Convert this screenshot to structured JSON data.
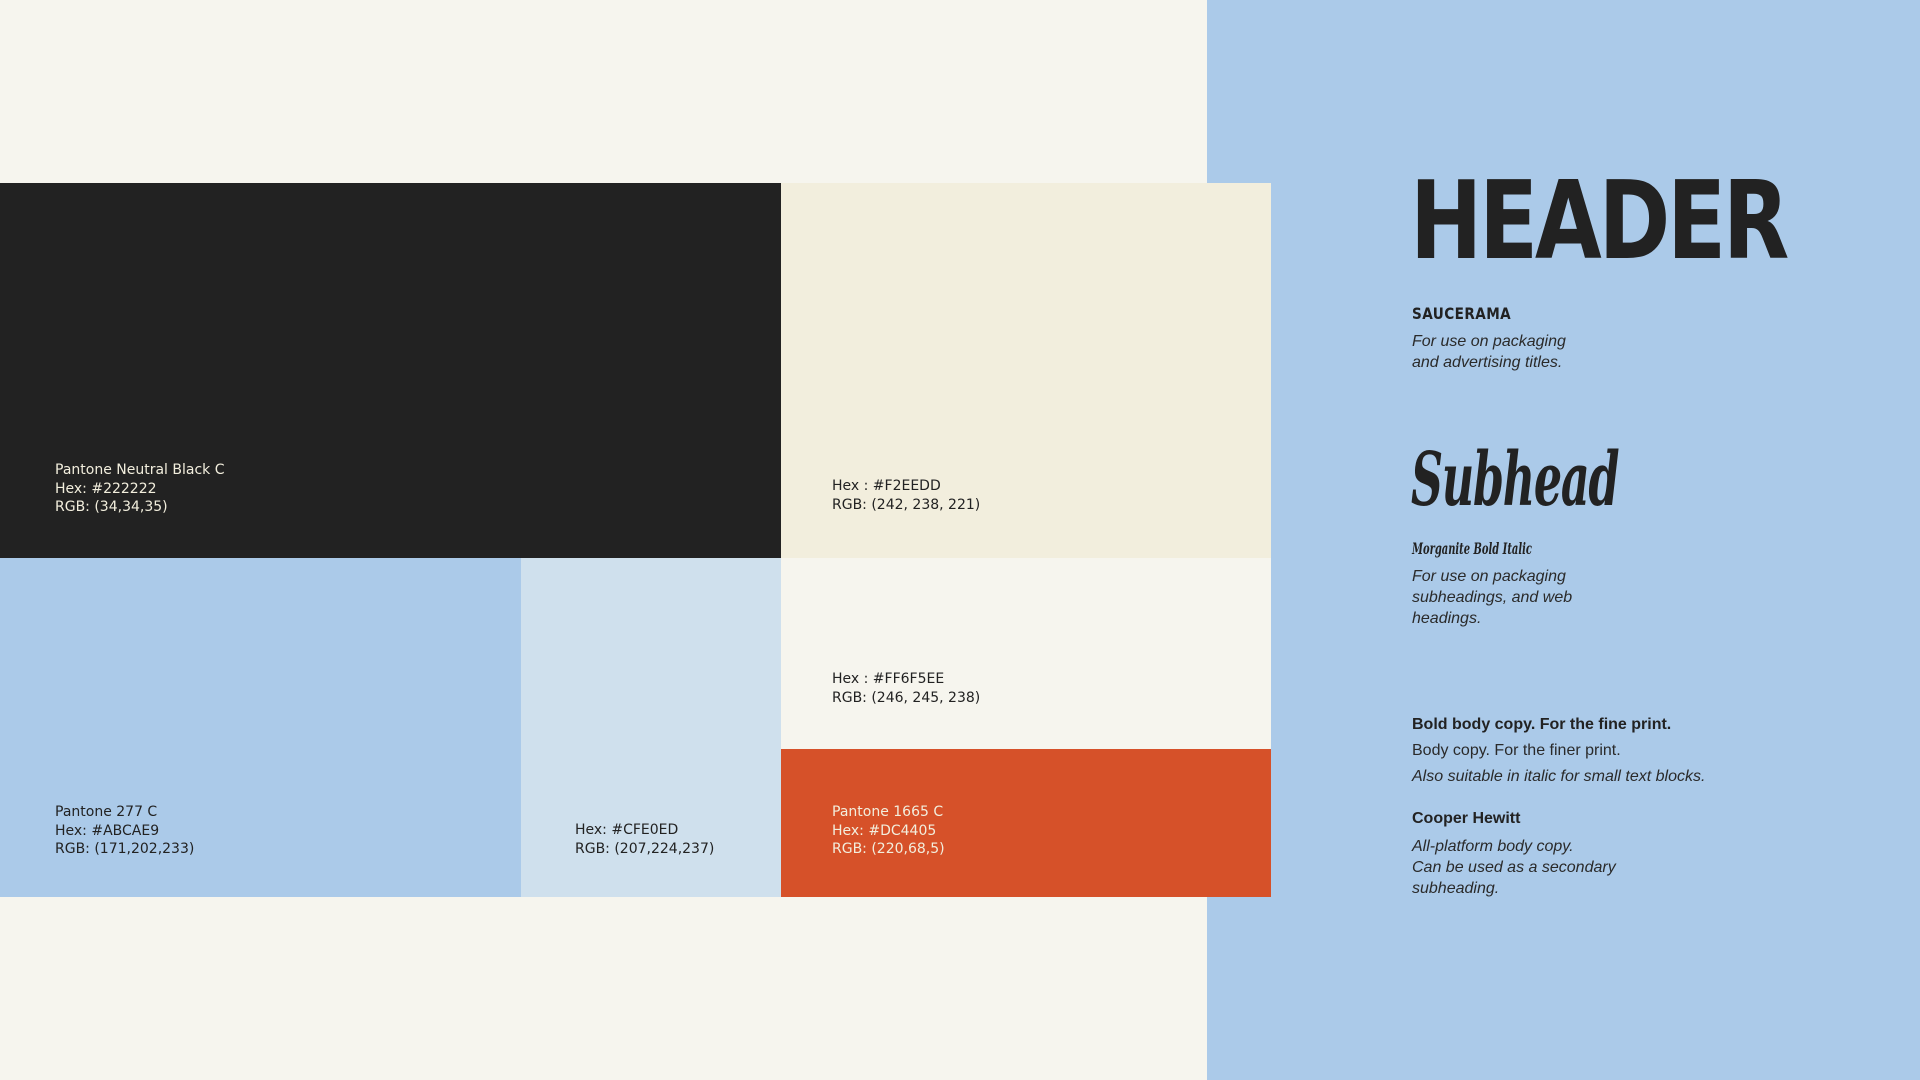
{
  "colors": {
    "neutral_black": "#222222",
    "cream": "#F2EEDD",
    "blue": "#ABCAE9",
    "light_blue": "#CFE0ED",
    "off_white": "#FF6F5EE",
    "orange": "#DC4405"
  },
  "swatches": {
    "black": {
      "name": "Pantone Neutral Black C",
      "hex": "Hex: #222222",
      "rgb": "RGB: (34,34,35)"
    },
    "cream": {
      "hex": "Hex : #F2EEDD",
      "rgb": "RGB: (242, 238, 221)"
    },
    "blue": {
      "name": "Pantone 277 C",
      "hex": "Hex: #ABCAE9",
      "rgb": "RGB: (171,202,233)"
    },
    "light_blue": {
      "hex": "Hex: #CFE0ED",
      "rgb": "RGB: (207,224,237)"
    },
    "off_white": {
      "hex": "Hex : #FF6F5EE",
      "rgb": "RGB: (246, 245, 238)"
    },
    "orange": {
      "name": "Pantone 1665 C",
      "hex": "Hex: #DC4405",
      "rgb": "RGB: (220,68,5)"
    }
  },
  "typography": {
    "header": {
      "sample": "HEADER",
      "font_name": "SAUCERAMA",
      "desc_line1": "For use on packaging",
      "desc_line2": "and advertising titles."
    },
    "subhead": {
      "sample": "Subhead",
      "font_name": "Morganite Bold Italic",
      "desc_line1": "For use on packaging",
      "desc_line2": "subheadings, and web",
      "desc_line3": "headings."
    },
    "body": {
      "bold_sample": "Bold body copy. For the fine print.",
      "regular_sample": "Body copy. For the finer print.",
      "italic_sample": "Also suitable in italic for small text blocks.",
      "font_name": "Cooper Hewitt",
      "desc_line1": "All-platform body copy.",
      "desc_line2": "Can be used as a secondary",
      "desc_line3": "subheading."
    }
  }
}
